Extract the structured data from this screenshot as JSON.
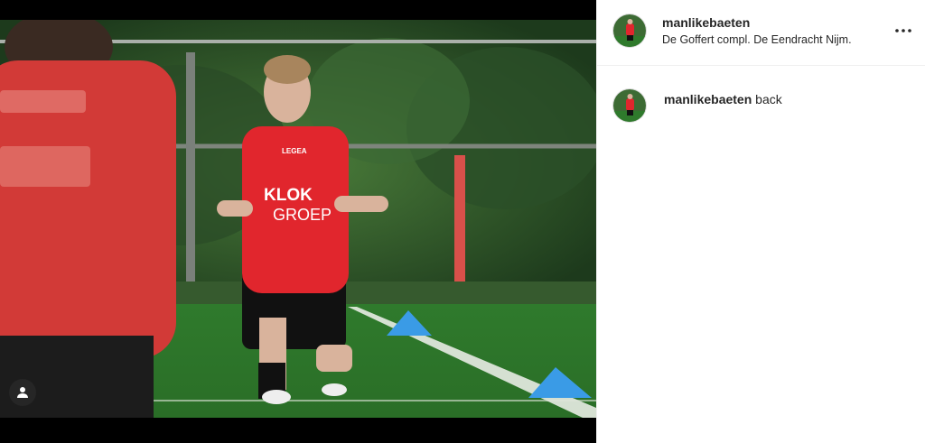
{
  "post": {
    "username": "manlikebaeten",
    "location": "De Goffert compl. De Eendracht Nijm.",
    "comment": {
      "username": "manlikebaeten",
      "text": "back"
    }
  },
  "photo": {
    "shirt_text": [
      "LEGEA",
      "KLOK",
      "GROEP"
    ],
    "brand_color": "#e1262d"
  },
  "icons": {
    "more": "more-horizontal-icon",
    "tag": "user-tag-icon"
  }
}
